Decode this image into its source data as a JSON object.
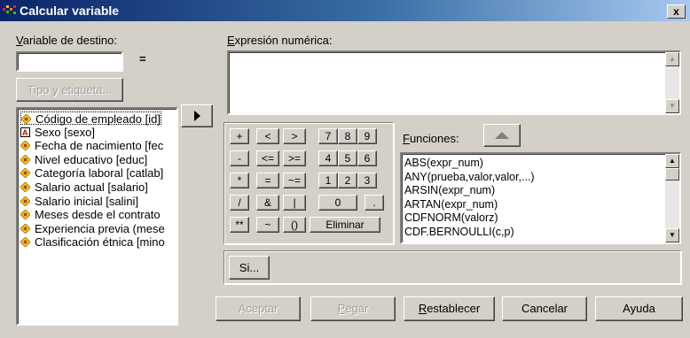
{
  "window": {
    "title": "Calcular variable",
    "close_glyph": "x"
  },
  "target": {
    "label": "Variable de destino:",
    "value": "",
    "equals": "=",
    "type_button": "Tipo y etiqueta..."
  },
  "expression": {
    "label": "Expresión numérica:",
    "value": ""
  },
  "variables": [
    {
      "label": "Código de empleado [id]",
      "icon": "scale-icon",
      "selected": true
    },
    {
      "label": "Sexo [sexo]",
      "icon": "string-icon",
      "selected": false
    },
    {
      "label": "Fecha de nacimiento [fec",
      "icon": "scale-icon",
      "selected": false
    },
    {
      "label": "Nivel educativo [educ]",
      "icon": "scale-icon",
      "selected": false
    },
    {
      "label": "Categoría laboral [catlab]",
      "icon": "scale-icon",
      "selected": false
    },
    {
      "label": "Salario actual [salario]",
      "icon": "scale-icon",
      "selected": false
    },
    {
      "label": "Salario inicial [salini]",
      "icon": "scale-icon",
      "selected": false
    },
    {
      "label": "Meses desde el contrato",
      "icon": "scale-icon",
      "selected": false
    },
    {
      "label": "Experiencia previa (mese",
      "icon": "scale-icon",
      "selected": false
    },
    {
      "label": "Clasificación étnica [mino",
      "icon": "scale-icon",
      "selected": false
    }
  ],
  "keypad": {
    "row1": [
      "+",
      "<",
      ">",
      "7",
      "8",
      "9"
    ],
    "row2": [
      "-",
      "<=",
      ">=",
      "4",
      "5",
      "6"
    ],
    "row3": [
      "*",
      "=",
      "~=",
      "1",
      "2",
      "3"
    ],
    "row4": [
      "/",
      "&",
      "|",
      "0",
      "."
    ],
    "row5": [
      "**",
      "~",
      "()",
      "Eliminar"
    ]
  },
  "functions": {
    "label": "Funciones:",
    "items": [
      "ABS(expr_num)",
      "ANY(prueba,valor,valor,...)",
      "ARSIN(expr_num)",
      "ARTAN(expr_num)",
      "CDFNORM(valorz)",
      "CDF.BERNOULLI(c,p)"
    ]
  },
  "if_button": "Si...",
  "buttons": {
    "ok": "Aceptar",
    "paste": "Pegar",
    "reset": "Restablecer",
    "cancel": "Cancelar",
    "help": "Ayuda"
  }
}
